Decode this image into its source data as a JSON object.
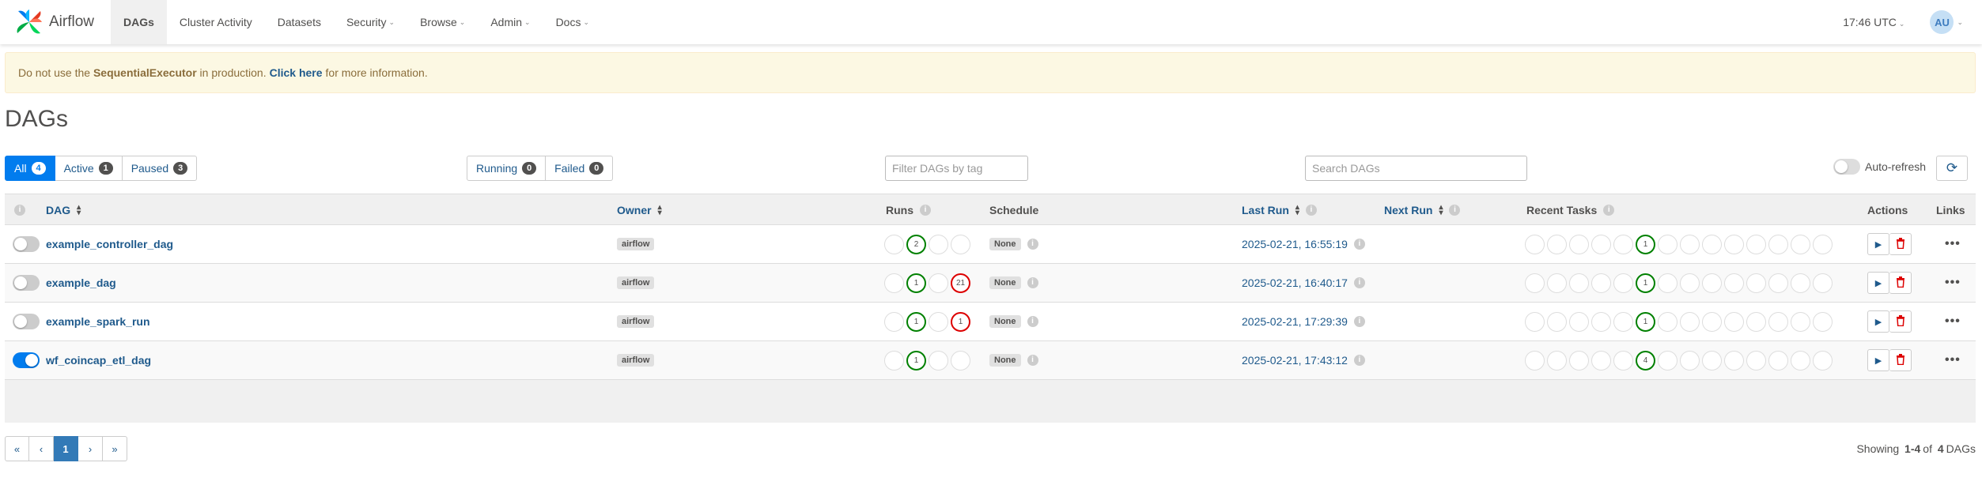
{
  "nav": {
    "brand": "Airflow",
    "items": [
      {
        "label": "DAGs",
        "caret": false,
        "active": true
      },
      {
        "label": "Cluster Activity",
        "caret": false
      },
      {
        "label": "Datasets",
        "caret": false
      },
      {
        "label": "Security",
        "caret": true
      },
      {
        "label": "Browse",
        "caret": true
      },
      {
        "label": "Admin",
        "caret": true
      },
      {
        "label": "Docs",
        "caret": true
      }
    ],
    "time": "17:46 UTC",
    "user_initials": "AU"
  },
  "alert": {
    "prefix": "Do not use the",
    "executor": "SequentialExecutor",
    "middle": "in production.",
    "link": "Click here",
    "suffix": "for more information."
  },
  "page_title": "DAGs",
  "filters": {
    "status": [
      {
        "label": "All",
        "count": "4"
      },
      {
        "label": "Active",
        "count": "1"
      },
      {
        "label": "Paused",
        "count": "3"
      }
    ],
    "run_state": [
      {
        "label": "Running",
        "count": "0"
      },
      {
        "label": "Failed",
        "count": "0"
      }
    ],
    "tag_placeholder": "Filter DAGs by tag",
    "search_placeholder": "Search DAGs",
    "auto_refresh_label": "Auto-refresh"
  },
  "table": {
    "headers": {
      "dag": "DAG",
      "owner": "Owner",
      "runs": "Runs",
      "schedule": "Schedule",
      "last_run": "Last Run",
      "next_run": "Next Run",
      "recent_tasks": "Recent Tasks",
      "actions": "Actions",
      "links": "Links"
    },
    "rows": [
      {
        "name": "example_controller_dag",
        "enabled": false,
        "owner": "airflow",
        "runs": [
          "",
          {
            "v": "2",
            "s": "green"
          },
          "",
          ""
        ],
        "schedule": "None",
        "last_run": "2025-02-21, 16:55:19",
        "task_success": "1"
      },
      {
        "name": "example_dag",
        "enabled": false,
        "owner": "airflow",
        "runs": [
          "",
          {
            "v": "1",
            "s": "green"
          },
          "",
          {
            "v": "21",
            "s": "red"
          }
        ],
        "schedule": "None",
        "last_run": "2025-02-21, 16:40:17",
        "task_success": "1"
      },
      {
        "name": "example_spark_run",
        "enabled": false,
        "owner": "airflow",
        "runs": [
          "",
          {
            "v": "1",
            "s": "green"
          },
          "",
          {
            "v": "1",
            "s": "red"
          }
        ],
        "schedule": "None",
        "last_run": "2025-02-21, 17:29:39",
        "task_success": "1"
      },
      {
        "name": "wf_coincap_etl_dag",
        "enabled": true,
        "owner": "airflow",
        "runs": [
          "",
          {
            "v": "1",
            "s": "green"
          },
          "",
          ""
        ],
        "schedule": "None",
        "last_run": "2025-02-21, 17:43:12",
        "task_success": "4"
      }
    ]
  },
  "pagination": {
    "first": "«",
    "prev": "‹",
    "current": "1",
    "next": "›",
    "last": "»"
  },
  "showing": {
    "prefix": "Showing",
    "range": "1-4",
    "of": "of",
    "total": "4",
    "suffix": "DAGs"
  },
  "colors": {
    "primary": "#017cee",
    "link": "#1f5a8c",
    "success": "#008000",
    "failed": "#d00"
  }
}
